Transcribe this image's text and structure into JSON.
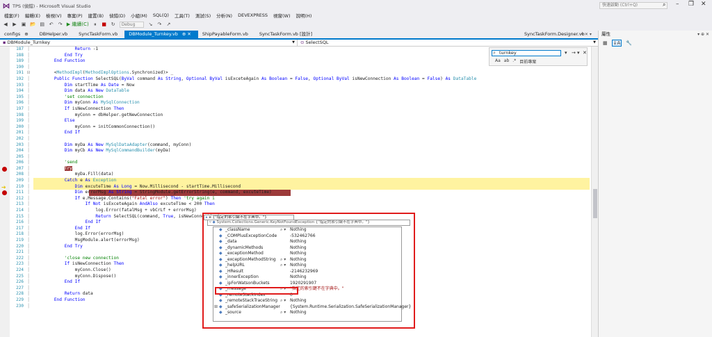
{
  "window": {
    "title": "TPS (偵錯) - Microsoft Visual Studio",
    "quick_launch_placeholder": "快速啟動 (Ctrl+Q)"
  },
  "menu": [
    "檔案(F)",
    "編輯(E)",
    "檢視(V)",
    "專案(P)",
    "建置(B)",
    "偵錯(D)",
    "小組(M)",
    "SQL(Q)",
    "工具(T)",
    "測試(S)",
    "分析(N)",
    "DEVEXPRESS",
    "視窗(W)",
    "說明(H)"
  ],
  "toolbar": {
    "start_label": "▶ 繼續(C)",
    "config": "Debug"
  },
  "tabs": [
    {
      "label": "configs"
    },
    {
      "label": "DBHelper.vb"
    },
    {
      "label": "SyncTaskForm.vb"
    },
    {
      "label": "DBModule_Turnkey.vb"
    },
    {
      "label": "ShipPayableForm.vb"
    },
    {
      "label": "SyncTaskForm.vb [設計]"
    }
  ],
  "right_tab": "SyncTaskForm.Designer.vb",
  "navbar": {
    "left": "DBModule_Turnkey",
    "right": "SelectSQL"
  },
  "find": {
    "value": "turnkey",
    "scope": "目前專案"
  },
  "properties_panel": {
    "title": "屬性"
  },
  "code_lines": [
    {
      "n": "187",
      "t": "                Return -1"
    },
    {
      "n": "188",
      "t": "            End Try"
    },
    {
      "n": "189",
      "t": "        End Function"
    },
    {
      "n": "190",
      "t": ""
    },
    {
      "n": "191",
      "t": "        <MethodImpl(MethodImplOptions.Synchronized)> _"
    },
    {
      "n": "192",
      "t": "        Public Function SelectSQL(ByVal command As String, Optional ByVal isExceteAgain As Boolean = False, Optional ByVal isNewConnection As Boolean = False) As DataTable"
    },
    {
      "n": "193",
      "t": "            Dim startTime As Date = Now"
    },
    {
      "n": "194",
      "t": "            Dim data As New DataTable"
    },
    {
      "n": "195",
      "t": "            'set connection"
    },
    {
      "n": "196",
      "t": "            Dim myConn As MySqlConnection"
    },
    {
      "n": "197",
      "t": "            If isNewConnection Then"
    },
    {
      "n": "198",
      "t": "                myConn = dbHelper.getNewConnection"
    },
    {
      "n": "199",
      "t": "            Else"
    },
    {
      "n": "200",
      "t": "                myConn = initCommonConnection()"
    },
    {
      "n": "201",
      "t": "            End If"
    },
    {
      "n": "202",
      "t": ""
    },
    {
      "n": "203",
      "t": "            Dim myDa As New MySqlDataAdapter(command, myConn)"
    },
    {
      "n": "204",
      "t": "            Dim myCb As New MySqlCommandBuilder(myDa)"
    },
    {
      "n": "205",
      "t": ""
    },
    {
      "n": "206",
      "t": "            'send"
    },
    {
      "n": "207",
      "t": "            Try"
    },
    {
      "n": "208",
      "t": "                myDa.Fill(data)"
    },
    {
      "n": "209",
      "t": "            Catch e As Exception"
    },
    {
      "n": "210",
      "t": "                Dim excuteTime As Long = Now.Millisecond - startTime.Millisecond"
    },
    {
      "n": "211",
      "t": "                Dim errorMsg As String = StringModule.getErrorString(e, command, excuteTime)"
    },
    {
      "n": "212",
      "t": "                If e.Message.Contains(\"Fatal error\") Then 'try again i"
    },
    {
      "n": "213",
      "t": "                    If Not isExceteAgain AndAlso excuteTime < 200 Then"
    },
    {
      "n": "214",
      "t": "                        log.Error(fatalMsg + vbCrLf + errorMsg)"
    },
    {
      "n": "215",
      "t": "                        Return SelectSQL(command, True, isNewConnection)"
    },
    {
      "n": "216",
      "t": "                    End If"
    },
    {
      "n": "217",
      "t": "                End If"
    },
    {
      "n": "218",
      "t": "                log.Error(errorMsg)"
    },
    {
      "n": "219",
      "t": "                MsgModule.alert(errorMsg)"
    },
    {
      "n": "220",
      "t": "            End Try"
    },
    {
      "n": "221",
      "t": ""
    },
    {
      "n": "222",
      "t": "            'close new connection"
    },
    {
      "n": "223",
      "t": "            If isNewConnection Then"
    },
    {
      "n": "224",
      "t": "                myConn.Close()"
    },
    {
      "n": "225",
      "t": "                myConn.Dispose()"
    },
    {
      "n": "226",
      "t": "            End If"
    },
    {
      "n": "227",
      "t": ""
    },
    {
      "n": "228",
      "t": "            Return data"
    },
    {
      "n": "229",
      "t": "        End Function"
    },
    {
      "n": "230",
      "t": ""
    }
  ],
  "datatip": {
    "head": "e  {\"指定的索引鍵不在字典中。\"}",
    "head2": "System.Collections.Generic.KeyNotFoundException  {\"指定的索引鍵不在字典中。\"}",
    "rows": [
      {
        "name": "_className",
        "value": "Nothing",
        "mag": true
      },
      {
        "name": "_COMPlusExceptionCode",
        "value": "-532462766"
      },
      {
        "name": "_data",
        "value": "Nothing"
      },
      {
        "name": "_dynamicMethods",
        "value": "Nothing"
      },
      {
        "name": "_exceptionMethod",
        "value": "Nothing"
      },
      {
        "name": "_exceptionMethodString",
        "value": "Nothing",
        "mag": true
      },
      {
        "name": "_helpURL",
        "value": "Nothing",
        "mag": true
      },
      {
        "name": "_HResult",
        "value": "-2146232969"
      },
      {
        "name": "_innerException",
        "value": "Nothing"
      },
      {
        "name": "_ipForWatsonBuckets",
        "value": "1920291907"
      },
      {
        "name": "_message",
        "value": "\"指定的索引鍵不在字典中。\"",
        "mag": true,
        "str": true
      },
      {
        "name": "_remoteStackIndex",
        "value": "0"
      },
      {
        "name": "_remoteStackTraceString",
        "value": "Nothing",
        "mag": true
      },
      {
        "name": "_safeSerializationManager",
        "value": "{System.Runtime.Serialization.SafeSerializationManager}",
        "expand": true
      },
      {
        "name": "_source",
        "value": "Nothing",
        "mag": true
      }
    ]
  },
  "colors": {
    "accent": "#007acc",
    "highlight_box": "#e01b1b",
    "breakpoint": "#c40000"
  }
}
